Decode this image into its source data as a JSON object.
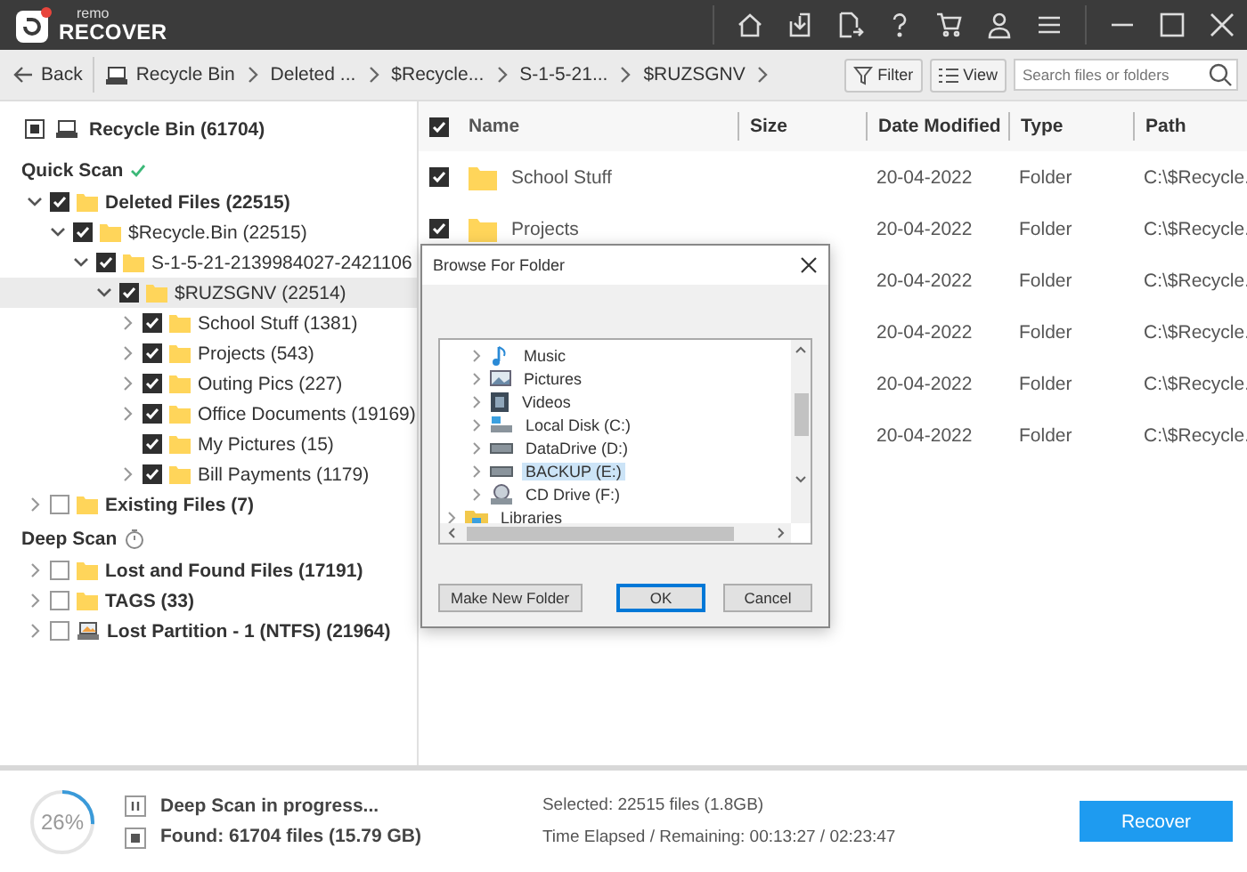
{
  "app": {
    "logo_small": "remo",
    "logo_main": "RECOVER"
  },
  "breadcrumb": {
    "back": "Back",
    "items": [
      {
        "label": "Recycle Bin",
        "kind": "drive"
      },
      {
        "label": "Deleted ...",
        "kind": "plain"
      },
      {
        "label": "$Recycle...",
        "kind": "plain"
      },
      {
        "label": "S-1-5-21...",
        "kind": "plain"
      },
      {
        "label": "$RUZSGNV",
        "kind": "plain"
      }
    ],
    "filter": "Filter",
    "view": "View",
    "search_placeholder": "Search files or folders"
  },
  "sidebar": {
    "root": {
      "label": "Recycle Bin (61704)",
      "indeterminate": true
    },
    "sections": [
      {
        "title": "Quick Scan",
        "complete": true,
        "items": [
          {
            "label": "Deleted Files (22515)",
            "checked": true,
            "expandable": true,
            "expanded": true,
            "kind": "folder",
            "selected": false,
            "children": [
              {
                "label": "$Recycle.Bin (22515)",
                "checked": true,
                "expandable": true,
                "expanded": true,
                "kind": "folder",
                "selected": false,
                "children": [
                  {
                    "label": "S-1-5-21-2139984027-2421106",
                    "checked": true,
                    "expandable": true,
                    "expanded": true,
                    "kind": "folder",
                    "selected": false,
                    "children": [
                      {
                        "label": "$RUZSGNV (22514)",
                        "checked": true,
                        "expandable": true,
                        "expanded": true,
                        "kind": "folder",
                        "selected": true,
                        "children": [
                          {
                            "label": "School Stuff (1381)",
                            "checked": true,
                            "expandable": true,
                            "expanded": false,
                            "kind": "folder",
                            "selected": false
                          },
                          {
                            "label": "Projects (543)",
                            "checked": true,
                            "expandable": true,
                            "expanded": false,
                            "kind": "folder",
                            "selected": false
                          },
                          {
                            "label": "Outing Pics (227)",
                            "checked": true,
                            "expandable": true,
                            "expanded": false,
                            "kind": "folder",
                            "selected": false
                          },
                          {
                            "label": "Office Documents (19169)",
                            "checked": true,
                            "expandable": true,
                            "expanded": false,
                            "kind": "folder",
                            "selected": false
                          },
                          {
                            "label": "My Pictures (15)",
                            "checked": true,
                            "expandable": false,
                            "kind": "folder",
                            "selected": false
                          },
                          {
                            "label": "Bill Payments (1179)",
                            "checked": true,
                            "expandable": true,
                            "expanded": false,
                            "kind": "folder",
                            "selected": false
                          }
                        ]
                      }
                    ]
                  }
                ]
              }
            ]
          },
          {
            "label": "Existing Files (7)",
            "checked": false,
            "expandable": true,
            "expanded": false,
            "kind": "folder",
            "selected": false
          }
        ]
      },
      {
        "title": "Deep Scan",
        "complete": false,
        "items": [
          {
            "label": "Lost and Found Files (17191)",
            "checked": false,
            "expandable": true,
            "expanded": false,
            "kind": "folder",
            "selected": false
          },
          {
            "label": "TAGS (33)",
            "checked": false,
            "expandable": true,
            "expanded": false,
            "kind": "folder",
            "selected": false
          },
          {
            "label": "Lost Partition - 1 (NTFS) (21964)",
            "checked": false,
            "expandable": true,
            "expanded": false,
            "kind": "partition",
            "selected": false
          }
        ]
      }
    ]
  },
  "table": {
    "header_checked": true,
    "columns": [
      "Name",
      "Size",
      "Date Modified",
      "Type",
      "Path"
    ],
    "rows": [
      {
        "checked": true,
        "name": "School Stuff",
        "date": "20-04-2022",
        "type": "Folder",
        "path": "C:\\$Recycle."
      },
      {
        "checked": true,
        "name": "Projects",
        "date": "20-04-2022",
        "type": "Folder",
        "path": "C:\\$Recycle."
      },
      {
        "date": "20-04-2022",
        "type": "Folder",
        "path": "C:\\$Recycle."
      },
      {
        "date": "20-04-2022",
        "type": "Folder",
        "path": "C:\\$Recycle."
      },
      {
        "date": "20-04-2022",
        "type": "Folder",
        "path": "C:\\$Recycle."
      },
      {
        "date": "20-04-2022",
        "type": "Folder",
        "path": "C:\\$Recycle."
      }
    ]
  },
  "dialog": {
    "title": "Browse For Folder",
    "tree": [
      {
        "children": [
          {
            "label": "Music",
            "kind": "music",
            "selected": false
          },
          {
            "label": "Pictures",
            "kind": "pictures",
            "selected": false
          },
          {
            "label": "Videos",
            "kind": "videos",
            "selected": false
          },
          {
            "label": "Local Disk (C:)",
            "kind": "system-drive",
            "selected": false
          },
          {
            "label": "DataDrive (D:)",
            "kind": "drive",
            "selected": false
          },
          {
            "label": "BACKUP (E:)",
            "kind": "drive",
            "selected": true
          },
          {
            "label": "CD Drive (F:)",
            "kind": "cd",
            "selected": false
          }
        ]
      },
      {
        "label": "Libraries",
        "kind": "library",
        "selected": false
      }
    ],
    "buttons": [
      {
        "label": "Make New Folder",
        "default": false
      },
      {
        "label": "OK",
        "default": true
      },
      {
        "label": "Cancel",
        "default": false
      }
    ]
  },
  "status": {
    "percent": "26%",
    "level": 0.26,
    "title": "Deep Scan in progress...",
    "found": "Found: 61704 files (15.79 GB)",
    "selected": "Selected: 22515 files (1.8GB)",
    "time": "Time Elapsed / Remaining: 00:13:27 / 02:23:47",
    "recover": "Recover"
  }
}
